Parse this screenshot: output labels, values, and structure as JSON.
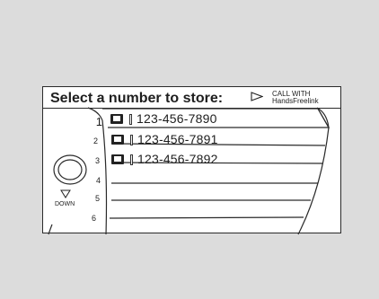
{
  "title": "Select a number to store:",
  "call_hint": {
    "icon": "play-outline-icon",
    "line1": "CALL WITH",
    "line2": "HandsFreelink"
  },
  "knob_label": "DOWN",
  "rows": [
    {
      "number": "1",
      "selected": true,
      "icon": "contact-card-icon",
      "phone": "123-456-7890"
    },
    {
      "number": "2",
      "selected": false,
      "icon": "phone-type-icon",
      "phone": "123-456-7891"
    },
    {
      "number": "3",
      "selected": false,
      "icon": "home-icon",
      "phone": "123-456-7892"
    },
    {
      "number": "4",
      "selected": false,
      "icon": "",
      "phone": ""
    },
    {
      "number": "5",
      "selected": false,
      "icon": "",
      "phone": ""
    },
    {
      "number": "6",
      "selected": false,
      "icon": "",
      "phone": ""
    }
  ]
}
